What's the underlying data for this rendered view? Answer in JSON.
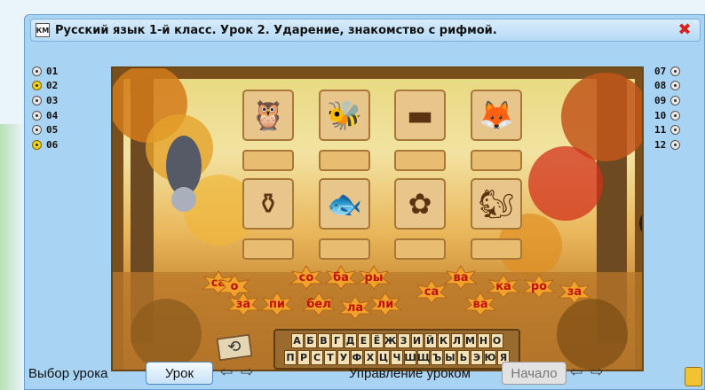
{
  "window": {
    "icon_text": "КМ",
    "title": "Русский язык 1-й класс. Урок 2. Ударение, знакомство с рифмой.",
    "close_icon": "close-icon"
  },
  "lessons_left": [
    {
      "num": "01",
      "active": false
    },
    {
      "num": "02",
      "active": true
    },
    {
      "num": "03",
      "active": false
    },
    {
      "num": "04",
      "active": false
    },
    {
      "num": "05",
      "active": false
    },
    {
      "num": "06",
      "active": true
    }
  ],
  "lessons_right": [
    {
      "num": "07"
    },
    {
      "num": "08"
    },
    {
      "num": "09"
    },
    {
      "num": "10"
    },
    {
      "num": "11"
    },
    {
      "num": "12"
    }
  ],
  "cards_row1": [
    "owl-icon",
    "bee-icon",
    "saw-icon",
    "fox-icon"
  ],
  "cards_row2": [
    "vase-icon",
    "fish-icon",
    "rose-icon",
    "squirrel-icon"
  ],
  "cards_glyphs": {
    "owl-icon": "🦉",
    "bee-icon": "🐝",
    "saw-icon": "▬",
    "fox-icon": "🦊",
    "vase-icon": "⚱",
    "fish-icon": "🐟",
    "rose-icon": "✿",
    "squirrel-icon": "🐿"
  },
  "syllables": [
    "са",
    "о",
    "за",
    "пи",
    "со",
    "ба",
    "ры",
    "бел",
    "ла",
    "ли",
    "са",
    "ва",
    "ва",
    "ка",
    "ро",
    "за"
  ],
  "keyboard": {
    "row1": [
      "А",
      "Б",
      "В",
      "Г",
      "Д",
      "Е",
      "Ё",
      "Ж",
      "З",
      "И",
      "Й",
      "К",
      "Л",
      "М",
      "Н",
      "О"
    ],
    "row2": [
      "П",
      "Р",
      "С",
      "Т",
      "У",
      "Ф",
      "Х",
      "Ц",
      "Ч",
      "Ш",
      "Щ",
      "Ъ",
      "Ы",
      "Ь",
      "Э",
      "Ю",
      "Я"
    ]
  },
  "bottom": {
    "select_label": "Выбор урока",
    "lesson_button": "Урок",
    "control_label": "Управление уроком",
    "start_button": "Начало"
  },
  "colors": {
    "window_bg": "#a9d3f3",
    "syllable_text": "#c01010",
    "active_lesson": "#f3d21c"
  }
}
